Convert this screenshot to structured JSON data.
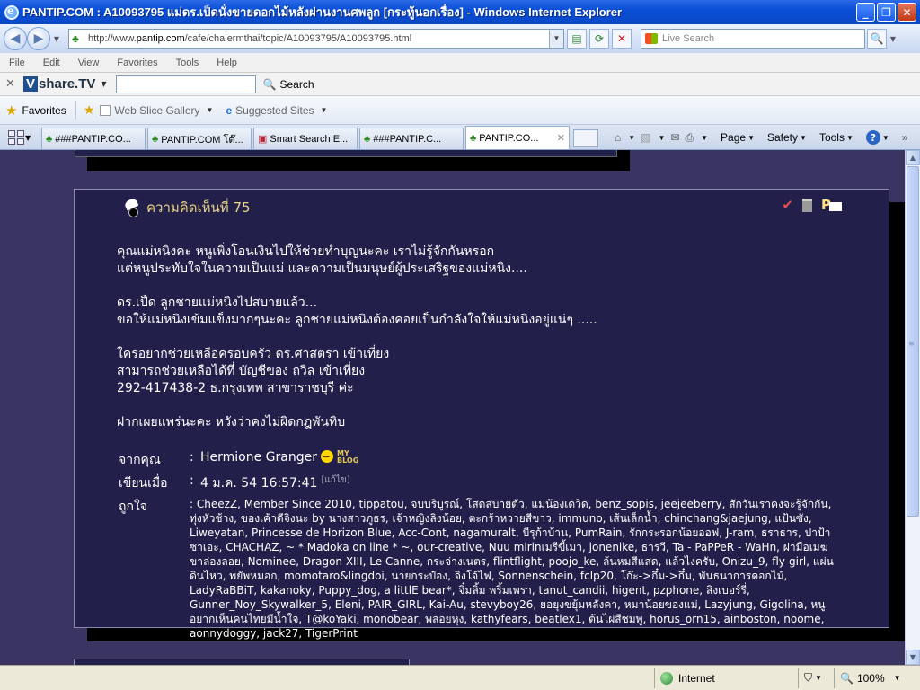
{
  "window": {
    "title": "PANTIP.COM : A10093795 แม่ดร.เป็ดนั่งขายดอกไม้หลังผ่านงานศพลูก [กระทู้นอกเรื่อง] - Windows Internet Explorer",
    "minimize": "_",
    "maximize": "❐",
    "close": "✕"
  },
  "address": {
    "url_prefix": "http://www.",
    "url_domain": "pantip.com",
    "url_path": "/cafe/chalermthai/topic/A10093795/A10093795.html",
    "search_placeholder": "Live Search"
  },
  "menu": [
    "File",
    "Edit",
    "View",
    "Favorites",
    "Tools",
    "Help"
  ],
  "vshare": {
    "logo_v": "V",
    "logo_rest": "share.TV",
    "search_label": "Search"
  },
  "favorites_bar": {
    "favorites_label": "Favorites",
    "web_slice": "Web Slice Gallery",
    "suggested": "Suggested Sites"
  },
  "tabs": [
    {
      "label": "###PANTIP.CO..."
    },
    {
      "label": "PANTIP.COM โต๊..."
    },
    {
      "label": "Smart Search E..."
    },
    {
      "label": "###PANTIP.C..."
    },
    {
      "label": "PANTIP.CO...",
      "active": true
    }
  ],
  "commands": {
    "page": "Page",
    "safety": "Safety",
    "tools": "Tools"
  },
  "post": {
    "title": "ความคิดเห็นที่ 75",
    "lines": [
      "คุณแม่หนิงคะ หนูเพิ่งโอนเงินไปให้ช่วยทำบุญนะคะ เราไม่รู้จักกันหรอก",
      "แต่หนูประทับใจในความเป็นแม่ และความเป็นมนุษย์ผู้ประเสริฐของแม่หนิง....",
      "",
      "ดร.เป็ด ลูกชายแม่หนิงไปสบายแล้ว...",
      "ขอให้แม่หนิงเข้มแข็งมากๆนะคะ ลูกชายแม่หนิงต้องคอยเป็นกำลังใจให้แม่หนิงอยู่แน่ๆ .....",
      "",
      "ใครอยากช่วยเหลือครอบครัว ดร.ศาสตรา เข้าเที่ยง",
      "สามารถช่วยเหลือได้ที่ บัญชีของ ถวิล เข้าเที่ยง",
      "292-417438-2 ธ.กรุงเทพ สาขาราชบุรี ค่ะ",
      "",
      "ฝากเผยแพร่นะคะ หวังว่าคงไม่ผิดกฎพันทิบ"
    ],
    "from_label": "จากคุณ",
    "from_value": "Hermione Granger",
    "blog_badge_1": "MY",
    "blog_badge_2": "BLOG",
    "written_label": "เขียนเมื่อ",
    "written_value": "4 ม.ค. 54 16:57:41",
    "edit_note": "[แก้ไข]",
    "likes_label": "ถูกใจ",
    "separator": ":",
    "likes_value": "CheezZ, Member Since 2010, tippatou, จบบริบูรณ์, โสดสบายตัว, แม่น้องเดวิด, benz_sopis, jeejeeberry, สักวันเราคงจะรู้จักกัน, ทุ่งหัวช้าง, ของเค้าดีจิงนะ by นางสาวภูธร, เจ้าหญิงลิงน้อย, ตะกร้าหวายสีขาว, immuno, เส้นเล็กน้ำ, chinchang&jaejung, แป้นซัง, Liweyatan, Princesse de Horizon Blue, Acc-Cont, nagamuralt, บีรุก้าบ้าน, PumRain, รักกระรอกน้อยออฟ, J-ram, ธราธาร, ปาป้าซาเอะ, CHACHAZ, ~ * Madoka on line * ~, our-creative, Nuu mirinเมรีขี้เมา, jonenike, ธารวี, Ta - PaPPeR - WaHn, ฝามือเมฆขาล่องลอย, Nominee, Dragon XIII, Le Canne, กระจ่างเนตร, flintflight, poojo_ke, ล้นหมสีแสด, แล้วไงครับ, Onizu_9, fly-girl, แผ่นดินไหว, พยัพหมอก, momotaro&lingdoi, นายกระป๋อง, จิงโจ้ไฟ, Sonnenschein, fclp20, โก๊ะ->กึ๋ม->กึ๋ม, พันธนาการดอกไม้, LadyRaBBiT, kakanoky, Puppy_dog, a littlE bear*, จิ๋มลิ้ม พริ้มเพรา, tanut_candii, higent, pzphone, ลิงเบอร์รี่, Gunner_Noy_Skywalker_5, Eleni, PAIR_GIRL, Kai-Au, stevyboy26, ยอยุงขยุ้มหลังคา, หมาน้อยของแม่, Lazyjung, Gigolina, หนูอยากเห็นคนไทยมีน้ำใจ, T@koYaki, monobear, พลอยหุง, kathyfears, beatlex1, ต้นไผ่สีชมพู, horus_orn15, ainboston, noome, aonnydoggy, jack27, TigerPrint"
  },
  "status": {
    "zone": "Internet",
    "zoom": "100%"
  }
}
